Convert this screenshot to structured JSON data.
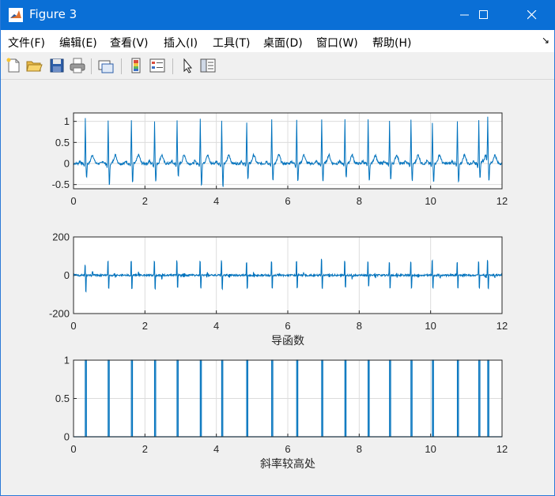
{
  "window": {
    "title": "Figure 3",
    "accent": "#0a6fd6",
    "app_icon": "matlab-logo-icon"
  },
  "menu": {
    "items": [
      "文件(F)",
      "编辑(E)",
      "查看(V)",
      "插入(I)",
      "工具(T)",
      "桌面(D)",
      "窗口(W)",
      "帮助(H)"
    ]
  },
  "toolbar": {
    "tools": [
      "new-figure-icon",
      "open-file-icon",
      "save-icon",
      "print-icon",
      "link-plot-icon",
      "insert-colorbar-icon",
      "insert-legend-icon",
      "edit-plot-icon",
      "open-property-inspector-icon"
    ]
  },
  "chart_data": [
    {
      "type": "line",
      "title": "",
      "xlabel": "",
      "ylabel": "",
      "xlim": [
        0,
        12
      ],
      "ylim": [
        -0.6,
        1.2
      ],
      "xticks": [
        "0",
        "2",
        "4",
        "6",
        "8",
        "10",
        "12"
      ],
      "yticks": [
        "-0.5",
        "0",
        "0.5",
        "1"
      ],
      "grid": true,
      "line_color": "#0072bd",
      "r_peaks_x": [
        0.33,
        0.97,
        1.62,
        2.27,
        2.9,
        3.55,
        4.15,
        4.85,
        5.55,
        6.25,
        6.95,
        7.6,
        8.25,
        8.85,
        9.45,
        10.05,
        10.75,
        11.35,
        11.6
      ],
      "r_peaks_y": [
        1.05,
        1.0,
        1.05,
        1.0,
        1.05,
        1.05,
        1.0,
        1.0,
        1.05,
        1.05,
        1.05,
        1.05,
        1.05,
        1.0,
        1.05,
        0.95,
        1.0,
        1.05,
        1.05
      ],
      "s_troughs_y": [
        -0.35,
        -0.55,
        -0.5,
        -0.45,
        -0.35,
        -0.55,
        -0.6,
        -0.4,
        -0.45,
        -0.45,
        -0.45,
        -0.35,
        -0.45,
        -0.4,
        -0.45,
        -0.45,
        -0.5,
        -0.4,
        -0.45
      ],
      "t_wave_amplitude": 0.2
    },
    {
      "type": "line",
      "title": "",
      "xlabel": "导函数",
      "ylabel": "",
      "xlim": [
        0,
        12
      ],
      "ylim": [
        -200,
        200
      ],
      "xticks": [
        "0",
        "2",
        "4",
        "6",
        "8",
        "10",
        "12"
      ],
      "yticks": [
        "-200",
        "0",
        "200"
      ],
      "grid": true,
      "line_color": "#0072bd",
      "spike_x": [
        0.33,
        0.97,
        1.62,
        2.27,
        2.9,
        3.55,
        4.15,
        4.85,
        5.55,
        6.25,
        6.95,
        7.6,
        8.25,
        8.85,
        9.45,
        10.05,
        10.75,
        11.35,
        11.6
      ],
      "spike_up": [
        90,
        120,
        120,
        120,
        120,
        120,
        120,
        110,
        120,
        120,
        140,
        120,
        110,
        110,
        120,
        130,
        110,
        120,
        130
      ],
      "spike_down": [
        -115,
        -95,
        -100,
        -95,
        -90,
        -95,
        -95,
        -90,
        -95,
        -95,
        -95,
        -90,
        -80,
        -95,
        -95,
        -95,
        -100,
        -90,
        -95
      ]
    },
    {
      "type": "line",
      "title": "",
      "xlabel": "斜率较高处",
      "ylabel": "",
      "xlim": [
        0,
        12
      ],
      "ylim": [
        0,
        1
      ],
      "xticks": [
        "0",
        "2",
        "4",
        "6",
        "8",
        "10",
        "12"
      ],
      "yticks": [
        "0",
        "0.5",
        "1"
      ],
      "grid": true,
      "line_color": "#0072bd",
      "pulse_intervals": [
        [
          0.33,
          0.36
        ],
        [
          0.97,
          1.0
        ],
        [
          1.62,
          1.65
        ],
        [
          2.27,
          2.3
        ],
        [
          2.9,
          2.93
        ],
        [
          3.55,
          3.58
        ],
        [
          4.15,
          4.18
        ],
        [
          4.85,
          4.88
        ],
        [
          5.55,
          5.58
        ],
        [
          6.25,
          6.28
        ],
        [
          6.95,
          6.98
        ],
        [
          7.6,
          7.63
        ],
        [
          8.25,
          8.28
        ],
        [
          8.85,
          8.88
        ],
        [
          9.45,
          9.48
        ],
        [
          10.05,
          10.08
        ],
        [
          10.75,
          10.78
        ],
        [
          11.35,
          11.38
        ],
        [
          11.6,
          11.63
        ]
      ]
    }
  ]
}
